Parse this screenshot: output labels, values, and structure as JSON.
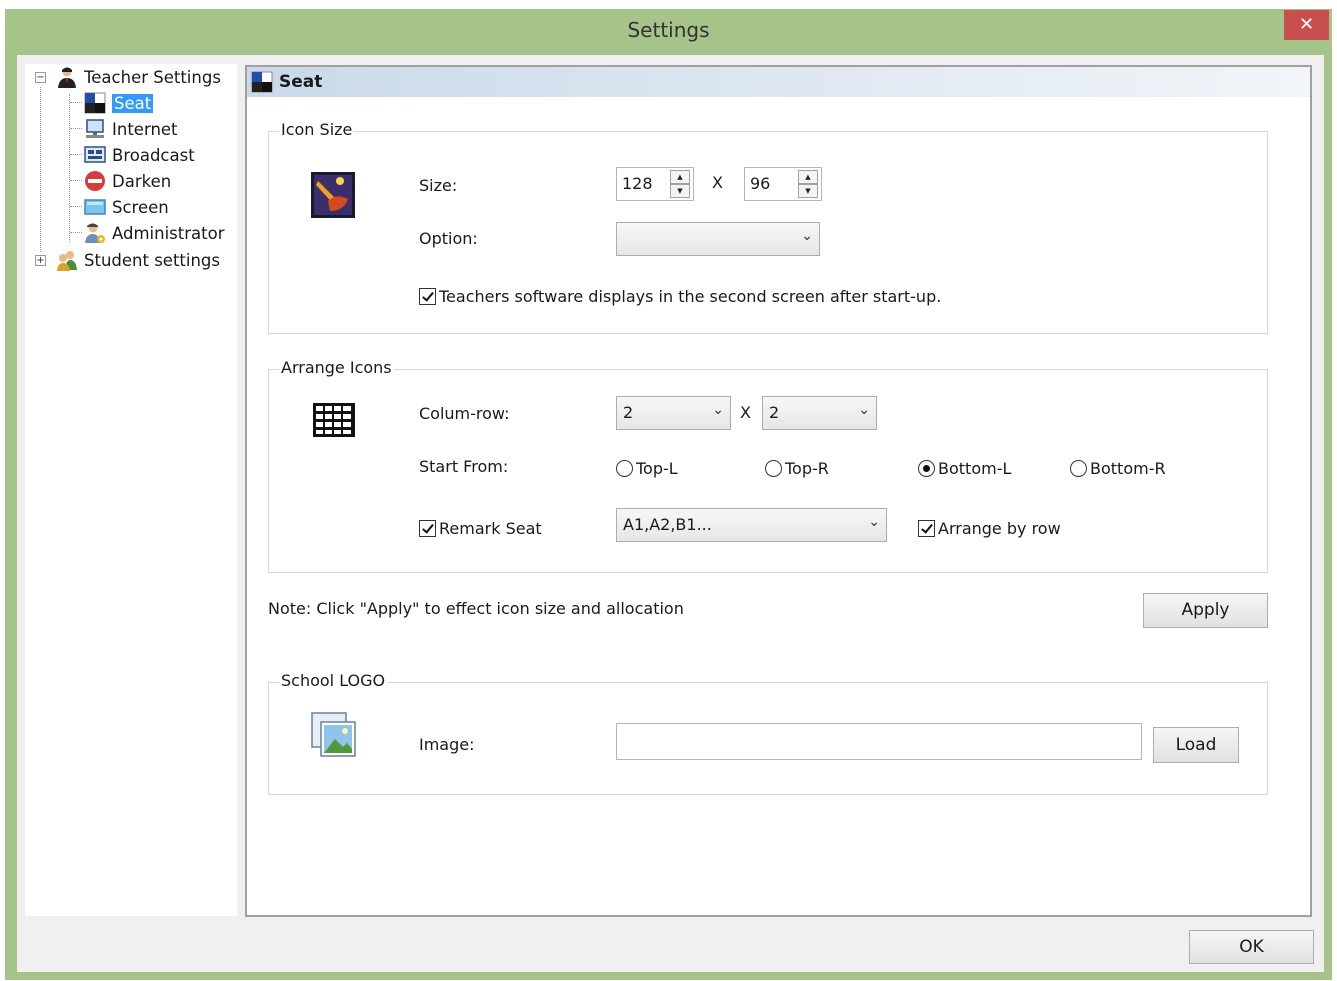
{
  "window": {
    "title": "Settings",
    "close_glyph": "✕"
  },
  "tree": {
    "teacher_settings": "Teacher Settings",
    "children": [
      "Seat",
      "Internet",
      "Broadcast",
      "Darken",
      "Screen",
      "Administrator"
    ],
    "student_settings": "Student settings",
    "expanded_glyph": "−",
    "collapsed_glyph": "+",
    "selected": "Seat"
  },
  "panel": {
    "title": "Seat",
    "icon_size": {
      "legend": "Icon Size",
      "size_label": "Size:",
      "width": "128",
      "times": "X",
      "height": "96",
      "option_label": "Option:",
      "option_value": "",
      "second_screen_label": "Teachers software displays in the second screen after start-up.",
      "second_screen_checked": true
    },
    "arrange_icons": {
      "legend": "Arrange Icons",
      "colrow_label": "Colum-row:",
      "columns": "2",
      "times": "X",
      "rows": "2",
      "start_from_label": "Start From:",
      "start_options": [
        "Top-L",
        "Top-R",
        "Bottom-L",
        "Bottom-R"
      ],
      "start_selected": "Bottom-L",
      "remark_seat_label": "Remark Seat",
      "remark_seat_checked": true,
      "remark_format": "A1,A2,B1...",
      "arrange_by_row_label": "Arrange by row",
      "arrange_by_row_checked": true
    },
    "note": "Note: Click \"Apply\" to effect icon size and allocation",
    "apply_label": "Apply",
    "school_logo": {
      "legend": "School LOGO",
      "image_label": "Image:",
      "image_value": "",
      "load_label": "Load"
    }
  },
  "ok_label": "OK",
  "colors": {
    "frame": "#a6c48a",
    "close": "#c94f4f",
    "selection": "#3399ff"
  }
}
